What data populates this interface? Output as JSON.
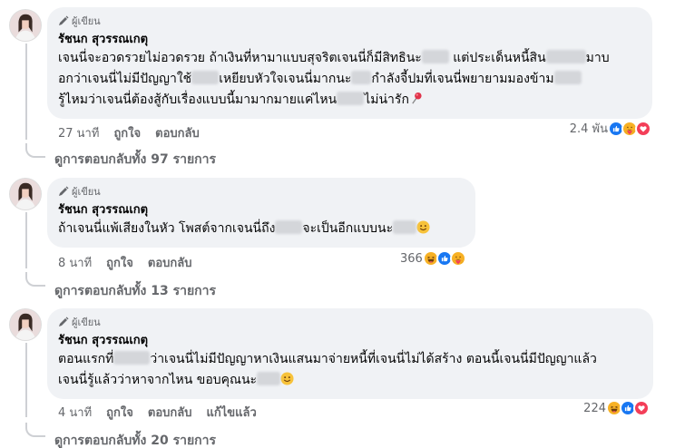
{
  "comments": [
    {
      "badge": "ผู้เขียน",
      "author": "รัชนก สุวรรณเกตุ",
      "lines": [
        [
          {
            "t": "เจนนี่จะอวดรวยไม่อวดรวย ถ้าเงินที่หามาแบบสุจริตเจนนี่ก็มีสิทธินะ"
          },
          {
            "b": 30
          },
          {
            "t": " แต่ประเด็นหนี้สิน"
          },
          {
            "b": 44
          },
          {
            "t": "มาบ"
          }
        ],
        [
          {
            "t": "อกว่าเจนนี่ไม่มีปัญญาใช้"
          },
          {
            "b": 30
          },
          {
            "t": "เหยียบหัวใจเจนนี่มากนะ"
          },
          {
            "b": 22
          },
          {
            "t": "กำลังจี้ปมที่เจนนี่พยายามมองข้าม"
          },
          {
            "b": 30
          }
        ],
        [
          {
            "t": "รู้ไหมว่าเจนนี่ต้องสู้กับเรื่องแบบนี้มามากมายแค่ไหน"
          },
          {
            "b": 30
          },
          {
            "t": "ไม่น่ารัก"
          },
          {
            "e": "pin"
          }
        ]
      ],
      "time": "27 นาที",
      "like": "ถูกใจ",
      "reply": "ตอบกลับ",
      "edited": "",
      "reaction_count": "2.4 พัน",
      "reaction_icons": [
        "like-icon",
        "care-icon",
        "love-icon"
      ],
      "replies_label": "ดูการตอบกลับทั้ง 97 รายการ"
    },
    {
      "badge": "ผู้เขียน",
      "author": "รัชนก สุวรรณเกตุ",
      "lines": [
        [
          {
            "t": "ถ้าเจนนี่แพ้เสียงในหัว โพสต์จากเจนนี่ถึง"
          },
          {
            "b": 30
          },
          {
            "t": "จะเป็นอีกแบบนะ"
          },
          {
            "b": 26
          },
          {
            "e": "smile"
          }
        ]
      ],
      "time": "8 นาที",
      "like": "ถูกใจ",
      "reply": "ตอบกลับ",
      "edited": "",
      "reaction_count": "366",
      "reaction_icons": [
        "haha-icon",
        "like-icon",
        "care-icon"
      ],
      "replies_label": "ดูการตอบกลับทั้ง 13 รายการ"
    },
    {
      "badge": "ผู้เขียน",
      "author": "รัชนก สุวรรณเกตุ",
      "lines": [
        [
          {
            "t": "ตอนแรกที่"
          },
          {
            "b": 40
          },
          {
            "t": "ว่าเจนนี่ไม่มีปัญญาหาเงินแสนมาจ่ายหนี้ที่เจนนี่ไม่ได้สร้าง ตอนนี้เจนนี่มีปัญญาแล้ว"
          }
        ],
        [
          {
            "t": "เจนนี่รู้แล้วว่าหาจากไหน ขอบคุณนะ"
          },
          {
            "b": 26
          },
          {
            "e": "smile"
          }
        ]
      ],
      "time": "4 นาที",
      "like": "ถูกใจ",
      "reply": "ตอบกลับ",
      "edited": "แก้ไขแล้ว",
      "reaction_count": "224",
      "reaction_icons": [
        "haha-icon",
        "like-icon",
        "love-icon"
      ],
      "replies_label": "ดูการตอบกลับทั้ง 20 รายการ"
    }
  ],
  "colors": {
    "like": "#1877f2",
    "love": "#f33e58",
    "care": "#f7b125",
    "haha": "#f7b125",
    "muted": "#65676b",
    "bubble": "#f0f2f5"
  }
}
